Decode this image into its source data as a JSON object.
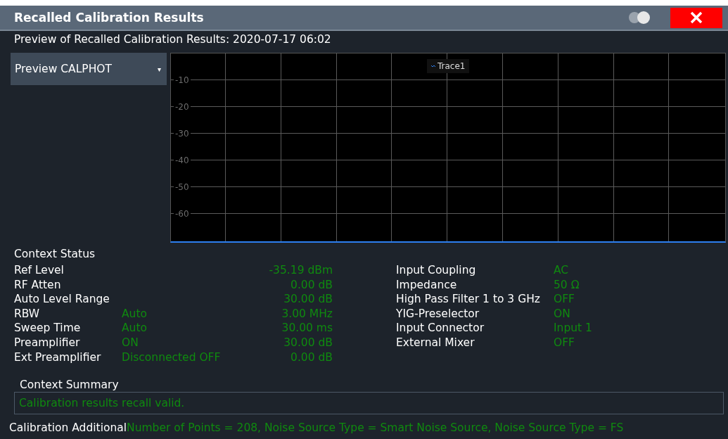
{
  "window": {
    "title": "Recalled Calibration Results"
  },
  "preview_heading": "Preview of Recalled Calibration Results: 2020-07-17 06:02",
  "preview_select": {
    "value": "Preview CALPHOT",
    "caret": "▾"
  },
  "plot": {
    "legend": "Trace1",
    "y_labels": [
      "-10",
      "-20",
      "-30",
      "-40",
      "-50",
      "-60"
    ]
  },
  "context_status": {
    "title": "Context Status",
    "left": [
      {
        "label": "Ref Level",
        "value": "-35.19 dBm"
      },
      {
        "label": "RF Atten",
        "value": "0.00 dB"
      },
      {
        "label": "Auto Level Range",
        "value": "30.00 dB"
      },
      {
        "label": "RBW",
        "mode": "Auto",
        "value": "3.00 MHz"
      },
      {
        "label": "Sweep Time",
        "mode": "Auto",
        "value": "30.00 ms"
      },
      {
        "label": "Preamplifier",
        "mode": "ON",
        "value": "30.00 dB"
      },
      {
        "label": "Ext Preamplifier",
        "mode": "Disconnected OFF",
        "value": "0.00 dB"
      }
    ],
    "right": [
      {
        "label": "Input Coupling",
        "value": "AC"
      },
      {
        "label": "Impedance",
        "value": "50 Ω"
      },
      {
        "label": "High Pass Filter 1 to 3 GHz",
        "value": "OFF"
      },
      {
        "label": "YIG-Preselector",
        "value": "ON"
      },
      {
        "label": "Input Connector",
        "value": "Input 1"
      },
      {
        "label": "External Mixer",
        "value": "OFF"
      }
    ]
  },
  "context_summary": {
    "title": "Context Summary",
    "message": "Calibration results recall valid."
  },
  "calibration_additional": {
    "label": "Calibration Additional",
    "value": "Number of Points = 208, Noise Source Type = Smart Noise Source, Noise Source Type = FS"
  }
}
